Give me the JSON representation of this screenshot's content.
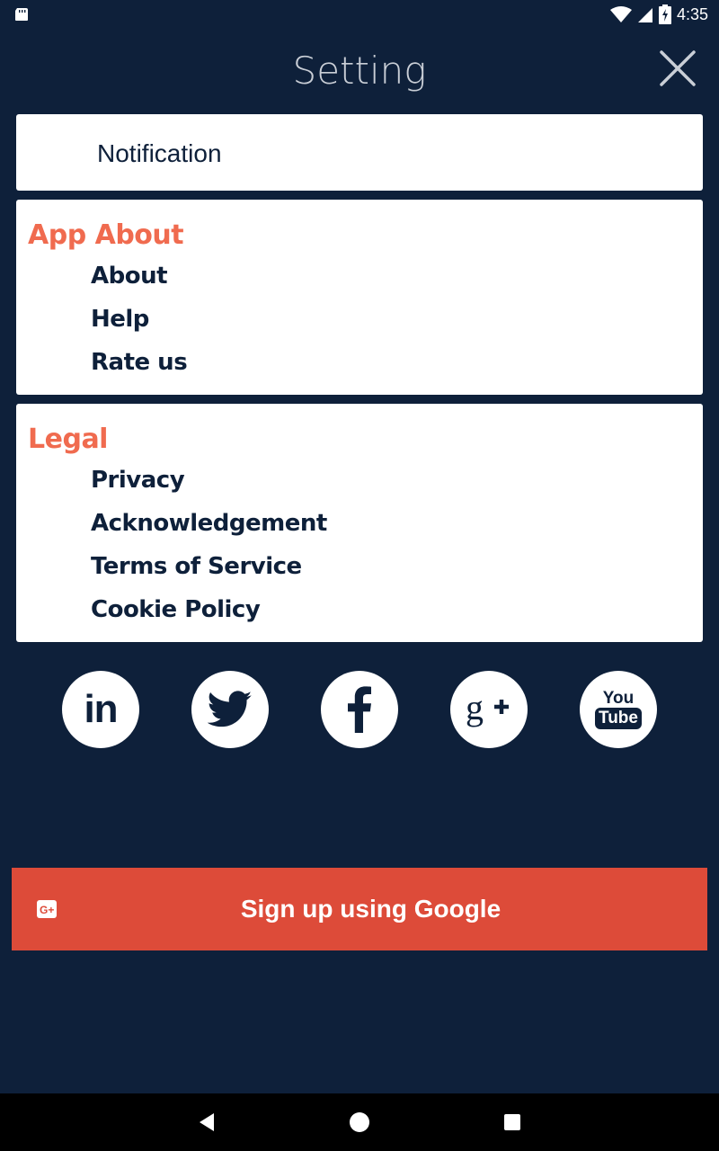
{
  "status_bar": {
    "time": "4:35"
  },
  "header": {
    "title": "Setting"
  },
  "notification": {
    "label": "Notification"
  },
  "app_about": {
    "title": "App About",
    "items": [
      "About",
      "Help",
      "Rate us"
    ]
  },
  "legal": {
    "title": "Legal",
    "items": [
      "Privacy",
      "Acknowledgement",
      "Terms of Service",
      "Cookie Policy"
    ]
  },
  "social": {
    "linkedin_text": "in",
    "youtube_top": "You",
    "youtube_bottom": "Tube"
  },
  "google_button": {
    "label": "Sign up using Google",
    "icon_text": "G+"
  },
  "colors": {
    "background": "#0e203a",
    "accent": "#f06b4f",
    "google": "#dd4b39"
  }
}
